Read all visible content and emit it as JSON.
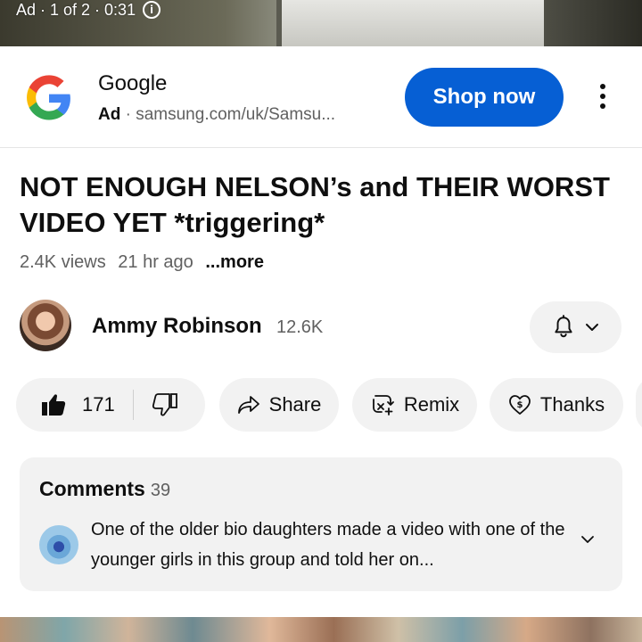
{
  "ad_video": {
    "counter_text": "Ad · 1 of 2 · 0:31"
  },
  "advertiser": {
    "name": "Google",
    "ad_label": "Ad",
    "separator": "·",
    "url": "samsung.com/uk/Samsu...",
    "cta_label": "Shop now"
  },
  "video": {
    "title": "NOT ENOUGH NELSON’s and THEIR WORST VIDEO YET *triggering*",
    "views": "2.4K views",
    "age": "21 hr ago",
    "more_label": "...more"
  },
  "channel": {
    "name": "Ammy Robinson",
    "subscribers": "12.6K"
  },
  "actions": {
    "like_count": "171",
    "share_label": "Share",
    "remix_label": "Remix",
    "thanks_label": "Thanks"
  },
  "comments": {
    "label": "Comments",
    "count": "39",
    "top_comment": "One of the older bio daughters made a video with one of the younger girls in this group and told her on..."
  },
  "colors": {
    "accent": "#065fd4",
    "pill_bg": "#f2f2f2",
    "secondary_text": "#606060"
  },
  "icons": {
    "info": "info-icon",
    "kebab": "more-vert-icon",
    "bell": "bell-icon",
    "like": "thumbs-up-icon",
    "dislike": "thumbs-down-icon",
    "share": "share-arrow-icon",
    "remix": "remix-icon",
    "thanks": "thanks-heart-dollar-icon",
    "expand": "chevron-down-icon"
  }
}
